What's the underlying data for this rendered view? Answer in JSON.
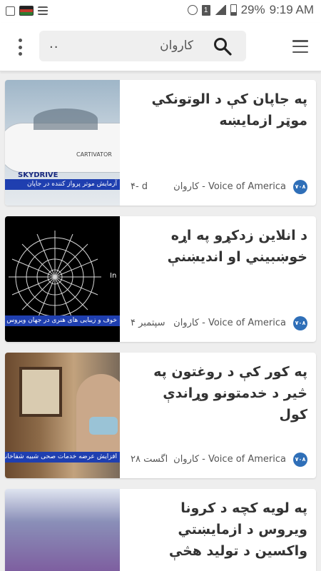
{
  "status_bar": {
    "battery": "29%",
    "time": "9:19 AM",
    "sim": "1"
  },
  "search": {
    "dots": "..",
    "query": "کاروان"
  },
  "cards": [
    {
      "title": "په جاپان کې د الوتونکي موټر ازمايښه",
      "source": "کاروان - Voice of America",
      "time": "۴- d",
      "caption": "آزمایش موتر پرواز کننده در جاپان",
      "thumb_brand": "CARTIVATOR",
      "thumb_label": "SKYDRIVE"
    },
    {
      "title": "د انلاين زدکړو په اړه خوښبيني او انديښنې",
      "source": "کاروان - Voice of America",
      "time": "سپتمبر ۴",
      "caption": "خوف و زیبایی های هنری در جهان ویروس",
      "thumb_label": "In"
    },
    {
      "title": "په کور کې د روغتون په څير د خدمتونو وړاندې کول",
      "source": "کاروان - Voice of America",
      "time": "اگست ۲۸",
      "caption": "افزایش عرضه خدمات صحی شبیه شفاخانه در"
    },
    {
      "title": "په لويه کچه د کرونا ويروس د ازمايښتي واکسين د توليد هڅې",
      "source": "",
      "time": "",
      "caption": ""
    }
  ],
  "source_logo": "۷۰۸",
  "colors": {
    "caption_bar": "#1f3fb0",
    "source_logo": "#2f6fb8"
  }
}
